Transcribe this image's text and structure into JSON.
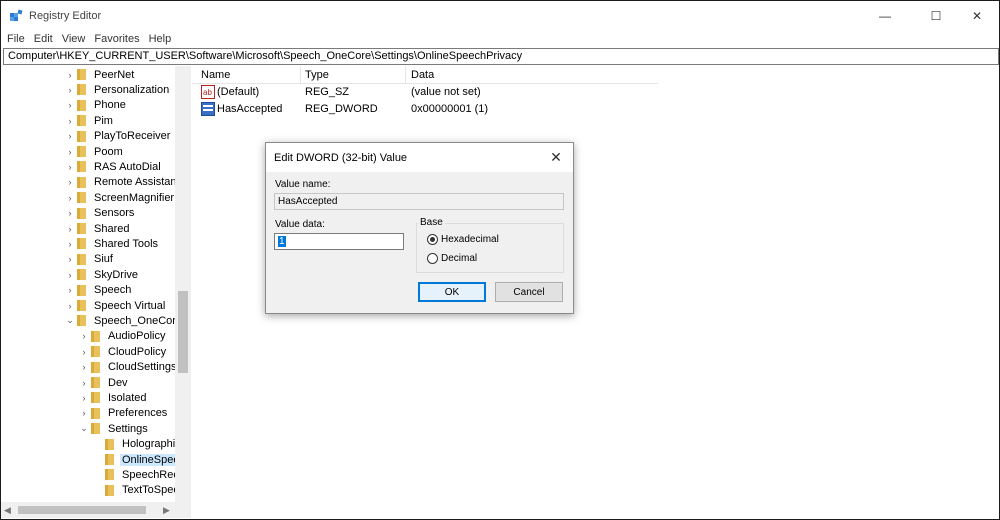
{
  "window": {
    "title": "Registry Editor",
    "controls": {
      "minimize": "—",
      "maximize": "☐",
      "close": "✕"
    }
  },
  "menu": [
    "File",
    "Edit",
    "View",
    "Favorites",
    "Help"
  ],
  "address": "Computer\\HKEY_CURRENT_USER\\Software\\Microsoft\\Speech_OneCore\\Settings\\OnlineSpeechPrivacy",
  "tree": [
    {
      "label": "PeerNet",
      "level": 0,
      "expander": "›"
    },
    {
      "label": "Personalization",
      "level": 0,
      "expander": "›"
    },
    {
      "label": "Phone",
      "level": 0,
      "expander": "›"
    },
    {
      "label": "Pim",
      "level": 0,
      "expander": "›"
    },
    {
      "label": "PlayToReceiver",
      "level": 0,
      "expander": "›"
    },
    {
      "label": "Poom",
      "level": 0,
      "expander": "›"
    },
    {
      "label": "RAS AutoDial",
      "level": 0,
      "expander": "›"
    },
    {
      "label": "Remote Assistanc",
      "level": 0,
      "expander": "›"
    },
    {
      "label": "ScreenMagnifier",
      "level": 0,
      "expander": "›"
    },
    {
      "label": "Sensors",
      "level": 0,
      "expander": "›"
    },
    {
      "label": "Shared",
      "level": 0,
      "expander": "›"
    },
    {
      "label": "Shared Tools",
      "level": 0,
      "expander": "›"
    },
    {
      "label": "Siuf",
      "level": 0,
      "expander": "›"
    },
    {
      "label": "SkyDrive",
      "level": 0,
      "expander": "›"
    },
    {
      "label": "Speech",
      "level": 0,
      "expander": "›"
    },
    {
      "label": "Speech Virtual",
      "level": 0,
      "expander": "›"
    },
    {
      "label": "Speech_OneCore",
      "level": 0,
      "expander": "⌄"
    },
    {
      "label": "AudioPolicy",
      "level": 1,
      "expander": "›"
    },
    {
      "label": "CloudPolicy",
      "level": 1,
      "expander": "›"
    },
    {
      "label": "CloudSettings",
      "level": 1,
      "expander": "›"
    },
    {
      "label": "Dev",
      "level": 1,
      "expander": "›"
    },
    {
      "label": "Isolated",
      "level": 1,
      "expander": "›"
    },
    {
      "label": "Preferences",
      "level": 1,
      "expander": "›"
    },
    {
      "label": "Settings",
      "level": 1,
      "expander": "⌄"
    },
    {
      "label": "Holographi",
      "level": 2,
      "expander": ""
    },
    {
      "label": "OnlineSpee",
      "level": 2,
      "expander": "",
      "selected": true
    },
    {
      "label": "SpeechReco",
      "level": 2,
      "expander": ""
    },
    {
      "label": "TextToSpee",
      "level": 2,
      "expander": ""
    }
  ],
  "scrollbars": {
    "left_arrow": "◀",
    "right_arrow": "▶"
  },
  "columns": {
    "name": "Name",
    "type": "Type",
    "data": "Data"
  },
  "values": [
    {
      "icon": "string-value-icon",
      "name": "(Default)",
      "type": "REG_SZ",
      "data": "(value not set)"
    },
    {
      "icon": "dword-value-icon",
      "name": "HasAccepted",
      "type": "REG_DWORD",
      "data": "0x00000001 (1)"
    }
  ],
  "dialog": {
    "title": "Edit DWORD (32-bit) Value",
    "close": "✕",
    "value_name_label": "Value name:",
    "value_name": "HasAccepted",
    "value_data_label": "Value data:",
    "value_data": "1",
    "base_label": "Base",
    "hex_label": "Hexadecimal",
    "dec_label": "Decimal",
    "base_selected": "Hexadecimal",
    "ok": "OK",
    "cancel": "Cancel"
  },
  "colors": {
    "folder": "#e8c15a",
    "selection": "#cce8ff",
    "accent": "#0078d7"
  }
}
